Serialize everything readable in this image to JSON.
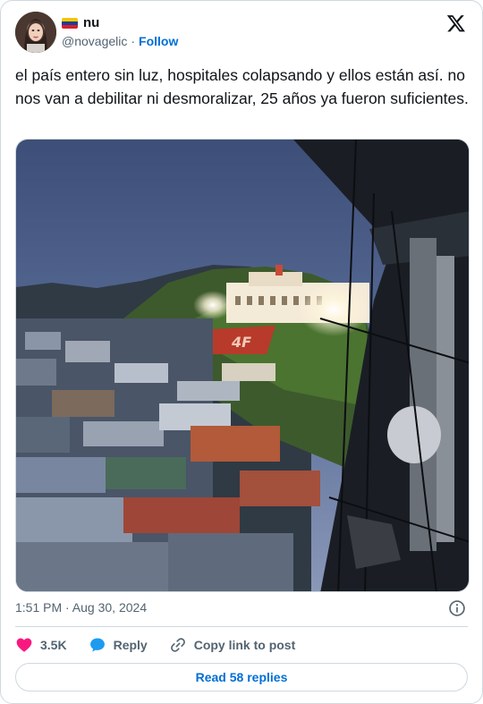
{
  "user": {
    "display_name": "nu",
    "handle": "@novagelic",
    "separator": "·",
    "follow_label": "Follow"
  },
  "tweet": {
    "text": "el país entero sin luz, hospitales colapsando y ellos están así. no nos van a debilitar ni desmoralizar, 25 años ya fueron suficientes.",
    "timestamp": "1:51 PM · Aug 30, 2024"
  },
  "actions": {
    "likes": "3.5K",
    "reply_label": "Reply",
    "copy_label": "Copy link to post"
  },
  "footer": {
    "read_replies_label": "Read 58 replies"
  },
  "media": {
    "sign_text": "4F"
  },
  "colors": {
    "link_blue": "#006fd6",
    "like_pink": "#f91880",
    "reply_blue": "#1d9bf0",
    "muted": "#536471",
    "border": "#cfd9de"
  }
}
